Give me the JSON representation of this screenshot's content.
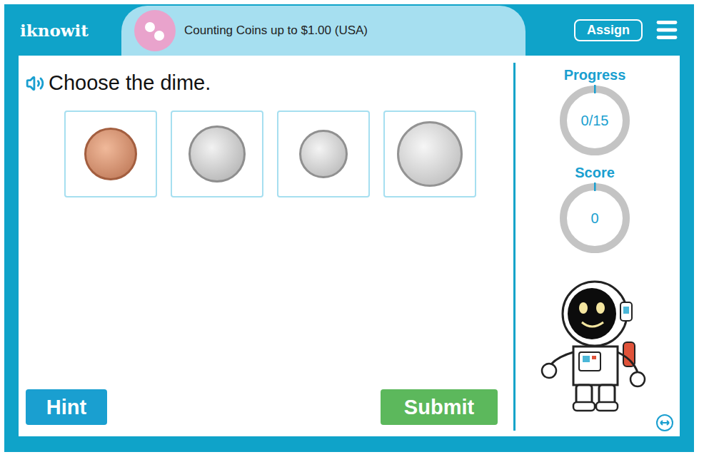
{
  "logo": "iknowit",
  "lesson": {
    "title": "Counting Coins up to $1.00 (USA)"
  },
  "header": {
    "assign": "Assign"
  },
  "question": {
    "prompt": "Choose the dime."
  },
  "choices": [
    {
      "kind": "penny",
      "selected": false
    },
    {
      "kind": "nickel",
      "selected": false
    },
    {
      "kind": "dime",
      "selected": false
    },
    {
      "kind": "quarter",
      "selected": false
    }
  ],
  "buttons": {
    "hint": "Hint",
    "submit": "Submit"
  },
  "progress": {
    "label": "Progress",
    "reading": "0/15",
    "level": 0
  },
  "score": {
    "label": "Score",
    "reading": "0",
    "level": 0
  }
}
